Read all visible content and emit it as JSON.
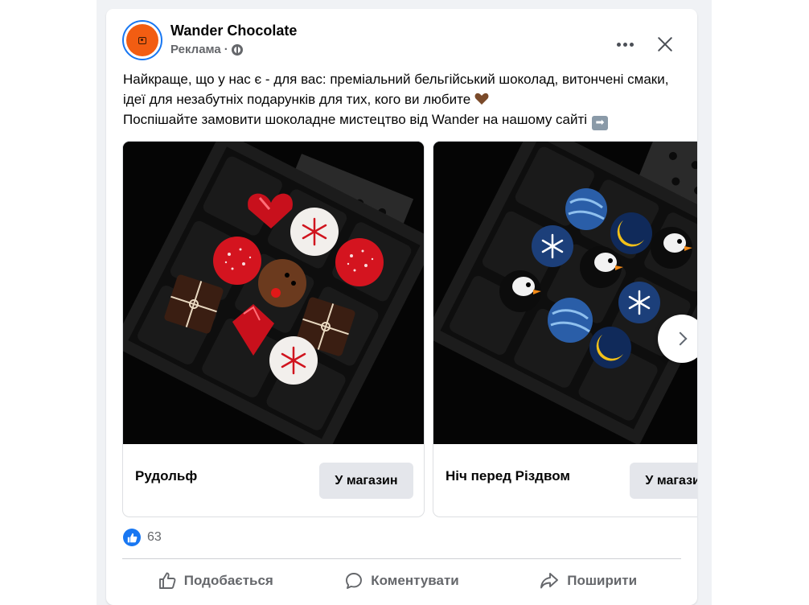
{
  "post": {
    "page_name": "Wander Chocolate",
    "sponsored_label": "Реклама",
    "separator": "·",
    "text_line1": "Найкраще, що у нас є - для вас: преміальний бельгійський шоколад, витончені смаки, ідеї для незабутніх подарунків для тих, кого ви любите",
    "text_line2": "Поспішайте замовити шоколадне мистецтво від Wander на нашому сайті",
    "icons": {
      "avatar": "wander-logo-icon",
      "audience": "globe-icon",
      "more": "more-horizontal-icon",
      "close": "close-icon",
      "heart_emoji": "brown-heart-emoji-icon",
      "arrow_emoji": "right-arrow-emoji-icon"
    }
  },
  "carousel": {
    "slides": [
      {
        "title": "Рудольф",
        "cta": "У магазин",
        "image": "chocolate-box-rudolph"
      },
      {
        "title": "Ніч перед Різдвом",
        "cta": "У магазин",
        "image": "chocolate-box-night-before-christmas"
      }
    ],
    "next_icon": "chevron-right-icon"
  },
  "reactions": {
    "count": "63",
    "icon": "like-icon"
  },
  "actions": [
    {
      "label": "Подобається",
      "icon": "thumbs-up-icon"
    },
    {
      "label": "Коментувати",
      "icon": "comment-icon"
    },
    {
      "label": "Поширити",
      "icon": "share-icon"
    }
  ],
  "colors": {
    "accent": "#1877f2",
    "avatar_bg": "#f25d12",
    "text_primary": "#050505",
    "text_secondary": "#65676b",
    "button_bg": "#e4e6eb",
    "feed_bg": "#f0f2f5"
  }
}
